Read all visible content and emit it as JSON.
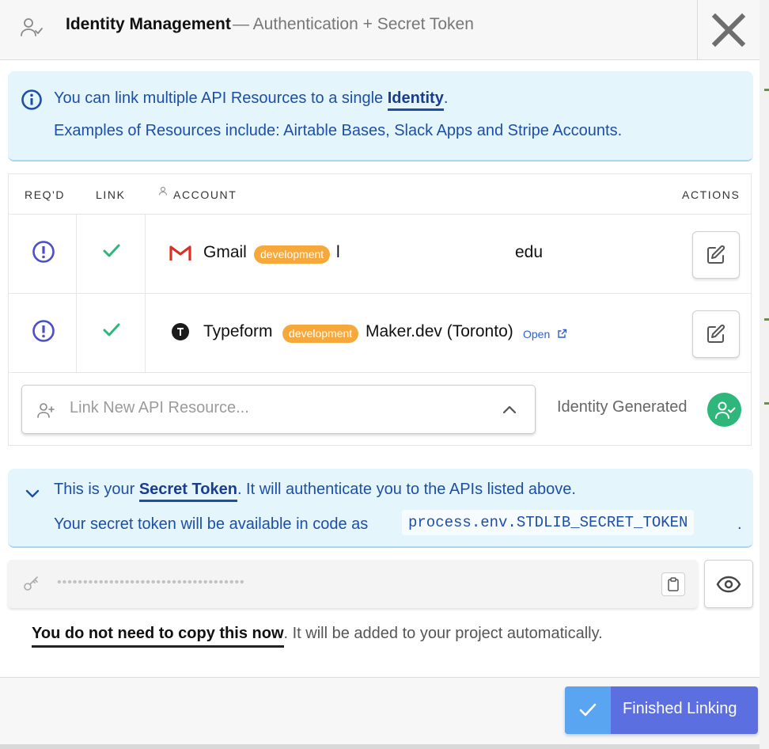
{
  "header": {
    "title": "Identity Management",
    "subtitle": "— Authentication + Secret Token"
  },
  "info_banner": {
    "line1_prefix": "You can link multiple API Resources to a single ",
    "line1_link": "Identity",
    "line1_suffix": ".",
    "line2": "Examples of Resources include: Airtable Bases, Slack Apps and Stripe Accounts."
  },
  "table": {
    "headers": {
      "required": "REQ'D",
      "link": "LINK",
      "account": "ACCOUNT",
      "actions": "ACTIONS"
    },
    "rows": [
      {
        "service": "Gmail",
        "badge": "development",
        "account_prefix": "l",
        "account_suffix": "edu"
      },
      {
        "service": "Typeform",
        "badge": "development",
        "account": "Maker.dev (Toronto)",
        "open_label": "Open"
      }
    ],
    "link_placeholder": "Link New API Resource...",
    "identity_status": "Identity Generated"
  },
  "secret_banner": {
    "line1_prefix": "This is your ",
    "line1_link": "Secret Token",
    "line1_suffix": ". It will authenticate you to the APIs listed above.",
    "line2": "Your secret token will be available in code as",
    "code": "process.env.STDLIB_SECRET_TOKEN",
    "period": "."
  },
  "token": {
    "masked": "••••••••••••••••••••••••••••••••••••"
  },
  "note": {
    "strong": "You do not need to copy this now",
    "rest": ". It will be added to your project automatically."
  },
  "footer": {
    "finish_label": "Finished Linking"
  },
  "colors": {
    "accent_blue": "#1d4fa8",
    "banner_bg": "#e5f5fc",
    "badge_orange": "#f6a83b",
    "success_green": "#2fb77b",
    "button_primary": "#5b6fe0"
  }
}
